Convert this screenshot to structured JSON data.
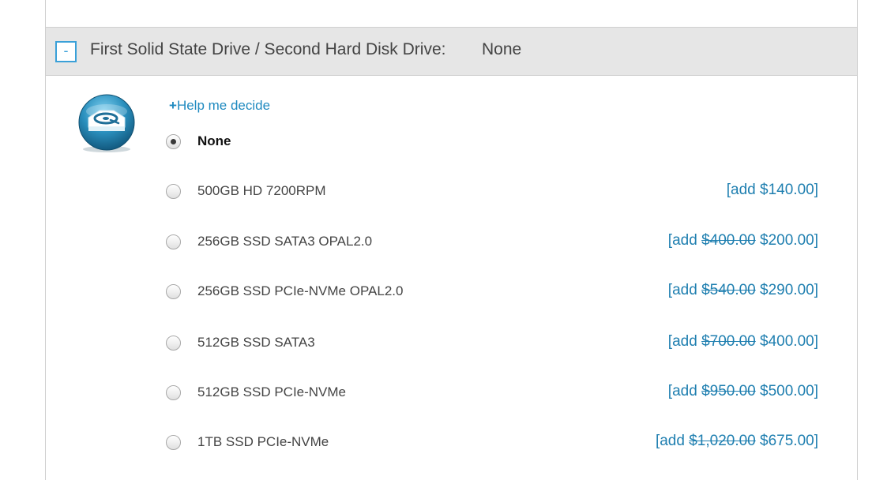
{
  "section": {
    "collapse_label": "-",
    "title": "First Solid State Drive / Second Hard Disk Drive:",
    "value": "None"
  },
  "help": {
    "plus": "+",
    "label": "Help me decide"
  },
  "colors": {
    "accent": "#1f8ac0",
    "header_bg": "#e6e6e6",
    "icon": "#2a8fbd"
  },
  "options": [
    {
      "label": "None",
      "selected": true,
      "price_prefix": "",
      "old_price": "",
      "new_price": "",
      "price_suffix": ""
    },
    {
      "label": "500GB HD 7200RPM",
      "selected": false,
      "price_prefix": "[add ",
      "old_price": "",
      "new_price": "$140.00",
      "price_suffix": "]"
    },
    {
      "label": "256GB SSD SATA3 OPAL2.0",
      "selected": false,
      "price_prefix": "[add ",
      "old_price": "$400.00",
      "new_price": "$200.00",
      "price_suffix": "]"
    },
    {
      "label": "256GB SSD PCIe-NVMe OPAL2.0",
      "selected": false,
      "price_prefix": "[add ",
      "old_price": "$540.00",
      "new_price": "$290.00",
      "price_suffix": "]"
    },
    {
      "label": "512GB SSD SATA3",
      "selected": false,
      "price_prefix": "[add ",
      "old_price": "$700.00",
      "new_price": "$400.00",
      "price_suffix": "]"
    },
    {
      "label": "512GB SSD PCIe-NVMe",
      "selected": false,
      "price_prefix": "[add ",
      "old_price": "$950.00",
      "new_price": "$500.00",
      "price_suffix": "]"
    },
    {
      "label": "1TB SSD PCIe-NVMe",
      "selected": false,
      "price_prefix": "[add ",
      "old_price": "$1,020.00",
      "new_price": "$675.00",
      "price_suffix": "]"
    }
  ]
}
